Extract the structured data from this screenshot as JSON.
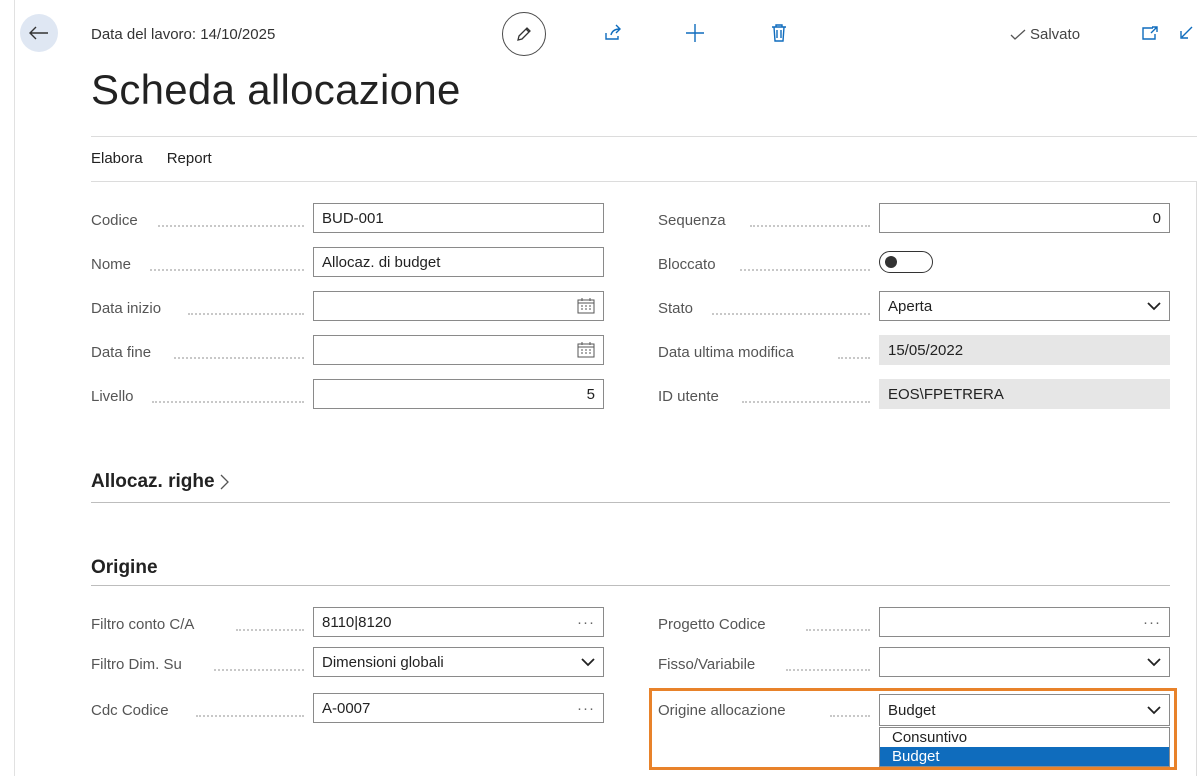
{
  "header": {
    "work_date": "Data del lavoro: 14/10/2025",
    "saved_label": "Salvato",
    "title": "Scheda allocazione"
  },
  "actions": {
    "elabora": "Elabora",
    "report": "Report"
  },
  "general": {
    "codice": {
      "label": "Codice",
      "value": "BUD-001"
    },
    "nome": {
      "label": "Nome",
      "value": "Allocaz. di budget"
    },
    "data_inizio": {
      "label": "Data inizio",
      "value": ""
    },
    "data_fine": {
      "label": "Data fine",
      "value": ""
    },
    "livello": {
      "label": "Livello",
      "value": "5"
    },
    "sequenza": {
      "label": "Sequenza",
      "value": "0"
    },
    "bloccato": {
      "label": "Bloccato",
      "value": false
    },
    "stato": {
      "label": "Stato",
      "value": "Aperta"
    },
    "data_ultima_modifica": {
      "label": "Data ultima modifica",
      "value": "15/05/2022"
    },
    "id_utente": {
      "label": "ID utente",
      "value": "EOS\\FPETRERA"
    }
  },
  "sections": {
    "righe": "Allocaz. righe",
    "origine": "Origine"
  },
  "origine": {
    "filtro_conto": {
      "label": "Filtro conto C/A",
      "value": "8110|8120"
    },
    "filtro_dim": {
      "label": "Filtro Dim. Su",
      "value": "Dimensioni globali"
    },
    "cdc_codice": {
      "label": "Cdc Codice",
      "value": "A-0007"
    },
    "progetto_codice": {
      "label": "Progetto Codice",
      "value": ""
    },
    "fisso_variabile": {
      "label": "Fisso/Variabile",
      "value": ""
    },
    "origine_allocazione": {
      "label": "Origine allocazione",
      "value": "Budget",
      "options": [
        "Consuntivo",
        "Budget"
      ]
    }
  },
  "colors": {
    "accent": "#0f6cbd",
    "highlight": "#e8822a"
  },
  "icons": [
    "back-arrow-icon",
    "edit-pencil-icon",
    "share-icon",
    "add-icon",
    "delete-icon",
    "checkmark-icon",
    "open-new-window-icon",
    "collapse-icon",
    "calendar-icon",
    "chevron-down-icon",
    "ellipsis-icon",
    "chevron-right-icon"
  ]
}
